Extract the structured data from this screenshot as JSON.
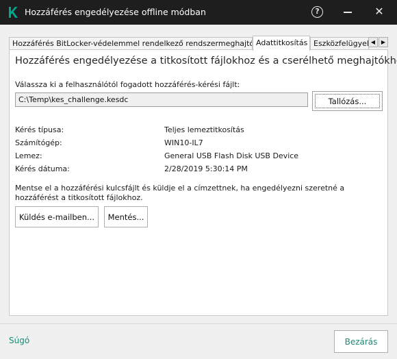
{
  "window": {
    "title": "Hozzáférés engedélyezése offline módban",
    "help_glyph": "?",
    "close_glyph": "✕",
    "icons": [
      "kaspersky-logo",
      "help-icon",
      "minimize-icon",
      "close-icon"
    ]
  },
  "tabs": [
    {
      "label": "Hozzáférés BitLocker-védelemmel rendelkező rendszermeghajtóhoz",
      "active": false
    },
    {
      "label": "Adattitkosítás",
      "active": true
    },
    {
      "label": "Eszközfelügyelet",
      "active": false
    }
  ],
  "tab_scroll": {
    "left": "◀",
    "right": "▶"
  },
  "panel": {
    "heading": "Hozzáférés engedélyezése a titkosított fájlokhoz és a cserélhető meghajtókhoz",
    "file_prompt": "Válassza ki a felhasználótól fogadott hozzáférés-kérési fájlt:",
    "file_path": "C:\\Temp\\kes_challenge.kesdc",
    "browse_label": "Tallózás...",
    "info": [
      {
        "key": "Kérés típusa:",
        "value": "Teljes lemeztitkosítás"
      },
      {
        "key": "Számítógép:",
        "value": "WIN10-IL7"
      },
      {
        "key": "Lemez:",
        "value": "General USB Flash Disk USB Device"
      },
      {
        "key": "Kérés dátuma:",
        "value": "2/28/2019 5:30:14 PM"
      }
    ],
    "note": "Mentse el a hozzáférési kulcsfájlt és küldje el a címzettnek, ha engedélyezni szeretné a hozzáférést a titkosított fájlokhoz.",
    "send_email_label": "Küldés e-mailben...",
    "save_label": "Mentés..."
  },
  "footer": {
    "help_label": "Súgó",
    "close_label": "Bezárás"
  },
  "colors": {
    "titlebar": "#1e1e1e",
    "accent": "#1a8a74",
    "logo": "#00a88e"
  }
}
